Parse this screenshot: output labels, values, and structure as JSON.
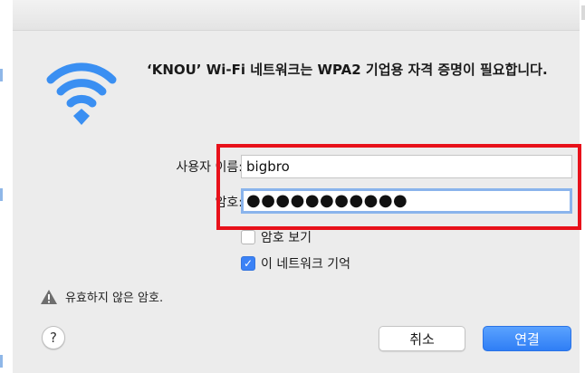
{
  "dialog": {
    "message": "‘KNOU’ Wi-Fi 네트워크는 WPA2 기업용 자격 증명이 필요합니다.",
    "wifi_icon": "wifi-icon",
    "username_label": "사용자 이름:",
    "username_value": "bigbro",
    "password_label": "암호:",
    "password_value": "●●●●●●●●●●●",
    "show_password_label": "암호 보기",
    "show_password_checked": false,
    "remember_network_label": "이 네트워크 기억",
    "remember_network_checked": true,
    "checkmark": "✓",
    "warning_text": "유효하지 않은 암호.",
    "help_label": "?",
    "cancel_label": "취소",
    "connect_label": "연결"
  },
  "colors": {
    "accent": "#3b82f6",
    "focus_ring": "#8ab4ec",
    "highlight": "#e8111a",
    "wifi": "#3a8ff2"
  }
}
